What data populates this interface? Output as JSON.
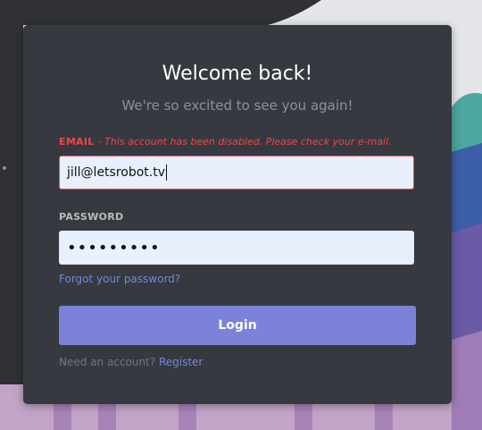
{
  "login": {
    "title": "Welcome back!",
    "subtitle": "We're so excited to see you again!",
    "email_label": "EMAIL",
    "email_error": "- This account has been disabled. Please check your e-mail.",
    "email_value": "jill@letsrobot.tv",
    "password_label": "PASSWORD",
    "password_value": "•••••••••",
    "forgot_link": "Forgot your password?",
    "login_button": "Login",
    "need_account": "Need an account?",
    "register_link": "Register"
  },
  "colors": {
    "card_bg": "#36393f",
    "accent": "#7289da",
    "error": "#f04747",
    "button": "#7b82d8"
  }
}
